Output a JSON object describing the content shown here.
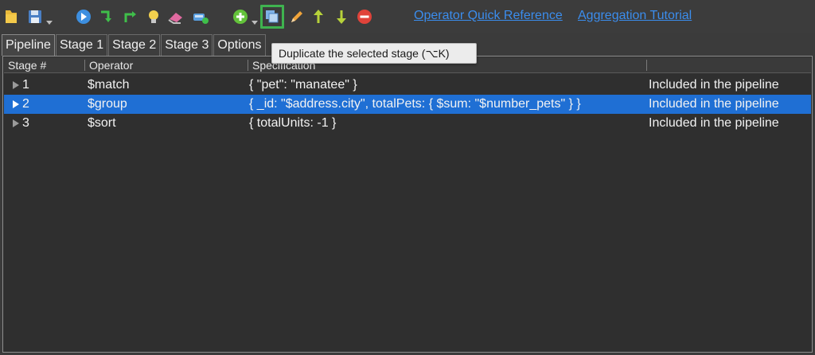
{
  "toolbar": {
    "links": {
      "operator_reference": "Operator Quick Reference",
      "aggregation_tutorial": "Aggregation Tutorial"
    }
  },
  "tabs": [
    "Pipeline",
    "Stage 1",
    "Stage 2",
    "Stage 3",
    "Options"
  ],
  "tooltip": "Duplicate the selected stage (⌥K)",
  "table": {
    "columns": [
      "Stage #",
      "Operator",
      "Specification",
      ""
    ],
    "rows": [
      {
        "stage": "1",
        "operator": "$match",
        "specification": "{ \"pet\": \"manatee\" }",
        "status": "Included in the pipeline",
        "selected": false
      },
      {
        "stage": "2",
        "operator": "$group",
        "specification": "{ _id: \"$address.city\", totalPets: { $sum: \"$number_pets\" } }",
        "status": "Included in the pipeline",
        "selected": true
      },
      {
        "stage": "3",
        "operator": "$sort",
        "specification": "{ totalUnits: -1 }",
        "status": "Included in the pipeline",
        "selected": false
      }
    ]
  },
  "colors": {
    "selection": "#1f6fd4",
    "link": "#3b8ded",
    "active_button_border": "#3fb34f"
  }
}
